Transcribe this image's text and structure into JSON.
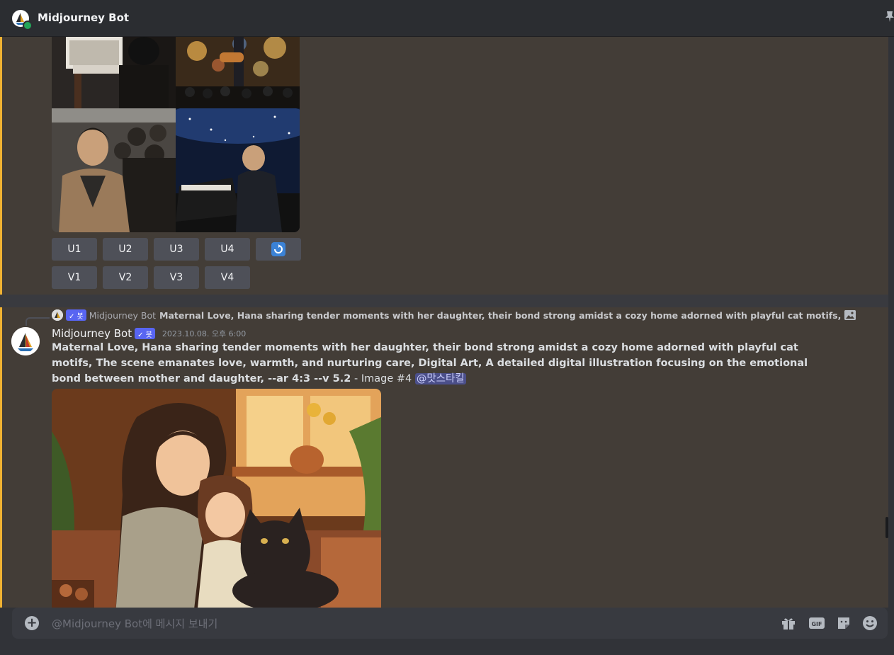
{
  "header": {
    "title": "Midjourney Bot"
  },
  "grid_buttons": {
    "row1": [
      "U1",
      "U2",
      "U3",
      "U4"
    ],
    "row2": [
      "V1",
      "V2",
      "V3",
      "V4"
    ],
    "refresh": "🔄"
  },
  "reply": {
    "bot_tag": "✓ 봇",
    "name": "Midjourney Bot",
    "text": "Maternal Love, Hana sharing tender moments with her daughter, their bond strong amidst a cozy home adorned with playful cat motifs, The scene emanates"
  },
  "message": {
    "author": "Midjourney Bot",
    "bot_tag": "✓ 봇",
    "timestamp": "2023.10.08. 오후 6:00",
    "prompt": "Maternal Love, Hana sharing tender moments with her daughter, their bond strong amidst a cozy home adorned with playful cat motifs, The scene emanates love, warmth, and nurturing care, Digital Art, A detailed digital illustration focusing on the emotional bond between mother and daughter, --ar 4:3 --v 5.2",
    "suffix": " - Image #4 ",
    "mention": "@맛스타킬"
  },
  "input": {
    "placeholder": "@Midjourney Bot에 메시지 보내기"
  },
  "colors": {
    "accent": "#5865f2",
    "highlight_bar": "#f0b232",
    "chat_bg": "#433d37"
  }
}
